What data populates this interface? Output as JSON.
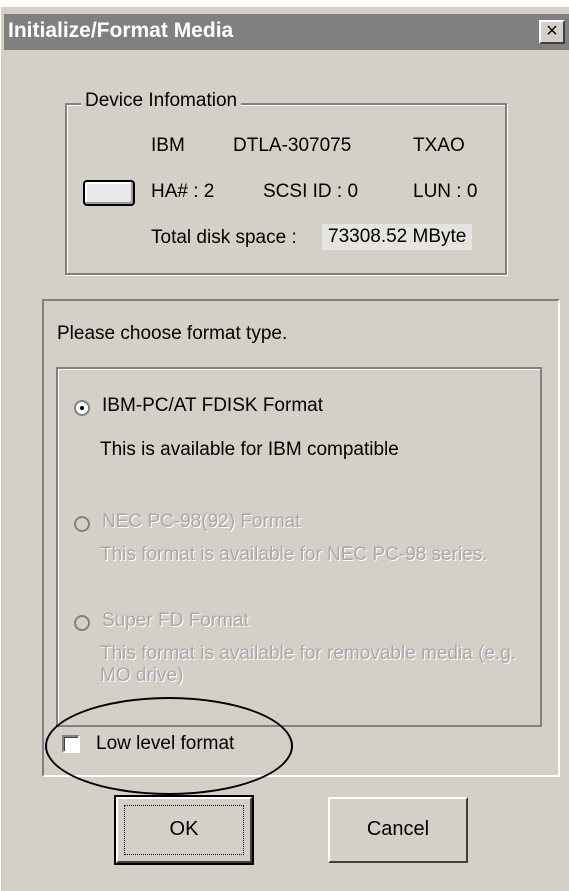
{
  "window": {
    "title": "Initialize/Format Media",
    "close_glyph": "×"
  },
  "device_info": {
    "legend": "Device Infomation",
    "icon": "disk-drive-icon",
    "vendor": "IBM",
    "model": "DTLA-307075",
    "revision": "TXAO",
    "ha": "HA# : 2",
    "scsi_id": "SCSI ID : 0",
    "lun": "LUN : 0",
    "space_label": "Total disk space :",
    "space_value": "73308.52 MByte"
  },
  "format": {
    "prompt": "Please choose format type.",
    "options": [
      {
        "label": "IBM-PC/AT  FDISK Format",
        "description": "This is available for IBM compatible",
        "selected": true,
        "enabled": true
      },
      {
        "label": "NEC PC-98(92) Format",
        "description": "This format is available for NEC PC-98 series.",
        "selected": false,
        "enabled": false
      },
      {
        "label": "Super FD Format",
        "description": "This format is available for removable media (e.g. MO drive)",
        "selected": false,
        "enabled": false
      }
    ],
    "low_level_label": "Low level format",
    "low_level_checked": false
  },
  "buttons": {
    "ok": "OK",
    "cancel": "Cancel"
  }
}
